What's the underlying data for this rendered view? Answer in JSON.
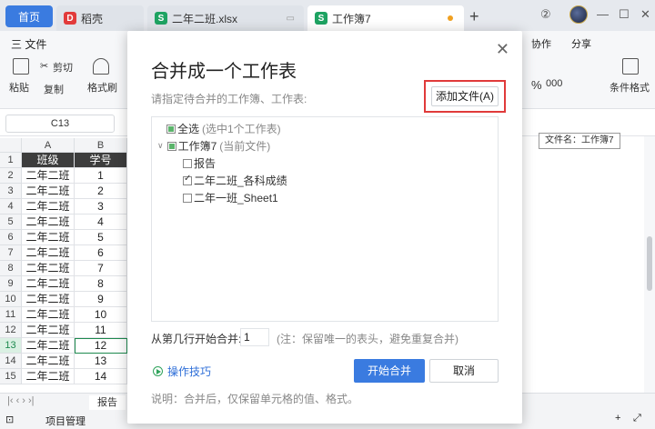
{
  "titlebar": {
    "tabs": [
      {
        "label": "首页"
      },
      {
        "label": "稻壳"
      },
      {
        "label": "二年二班.xlsx"
      },
      {
        "label": "工作簿7"
      }
    ],
    "new_tab": "+"
  },
  "ribbon": {
    "file_menu": "三 文件",
    "cut": "剪切",
    "paste": "粘贴",
    "copy": "复制",
    "format_painter": "格式刷",
    "collaborate": "协作",
    "share": "分享",
    "percent": "%",
    "thousands": "000",
    "cond_format": "条件格式"
  },
  "formula_bar": {
    "cell_ref": "C13"
  },
  "grid": {
    "columns": [
      "A",
      "B"
    ],
    "header_row": {
      "row": "1",
      "a": "班级",
      "b": "学号"
    },
    "rows": [
      {
        "row": "2",
        "a": "二年二班",
        "b": "1"
      },
      {
        "row": "3",
        "a": "二年二班",
        "b": "2"
      },
      {
        "row": "4",
        "a": "二年二班",
        "b": "3"
      },
      {
        "row": "5",
        "a": "二年二班",
        "b": "4"
      },
      {
        "row": "6",
        "a": "二年二班",
        "b": "5"
      },
      {
        "row": "7",
        "a": "二年二班",
        "b": "6"
      },
      {
        "row": "8",
        "a": "二年二班",
        "b": "7"
      },
      {
        "row": "9",
        "a": "二年二班",
        "b": "8"
      },
      {
        "row": "10",
        "a": "二年二班",
        "b": "9"
      },
      {
        "row": "11",
        "a": "二年二班",
        "b": "10"
      },
      {
        "row": "12",
        "a": "二年二班",
        "b": "11"
      },
      {
        "row": "13",
        "a": "二年二班",
        "b": "12"
      },
      {
        "row": "14",
        "a": "二年二班",
        "b": "13"
      },
      {
        "row": "15",
        "a": "二年二班",
        "b": "14"
      }
    ],
    "selected_row": "13"
  },
  "tooltip": "文件名：工作簿7",
  "sheetbar": {
    "sheet_tab": "报告"
  },
  "statusbar": {
    "project": "项目管理"
  },
  "dialog": {
    "title": "合并成一个工作表",
    "hint": "请指定待合并的工作簿、工作表:",
    "add_file": "添加文件(A)",
    "tree": {
      "select_all": "全选",
      "select_all_note": "(选中1个工作表)",
      "workbook": "工作簿7",
      "workbook_note": "(当前文件)",
      "sheets": [
        {
          "label": "报告",
          "checked": false
        },
        {
          "label": "二年二班_各科成绩",
          "checked": true
        },
        {
          "label": "二年一班_Sheet1",
          "checked": false
        }
      ]
    },
    "start_row_label": "从第几行开始合并:",
    "start_row_value": "1",
    "start_row_note": "(注：保留唯一的表头，避免重复合并)",
    "tips": "操作技巧",
    "start_button": "开始合并",
    "cancel_button": "取消",
    "footer": "说明：合并后，仅保留单元格的值、格式。"
  },
  "colors": {
    "accent": "#3a7be0",
    "highlight": "#e03a3a",
    "sheet_green": "#1e8a4f"
  }
}
